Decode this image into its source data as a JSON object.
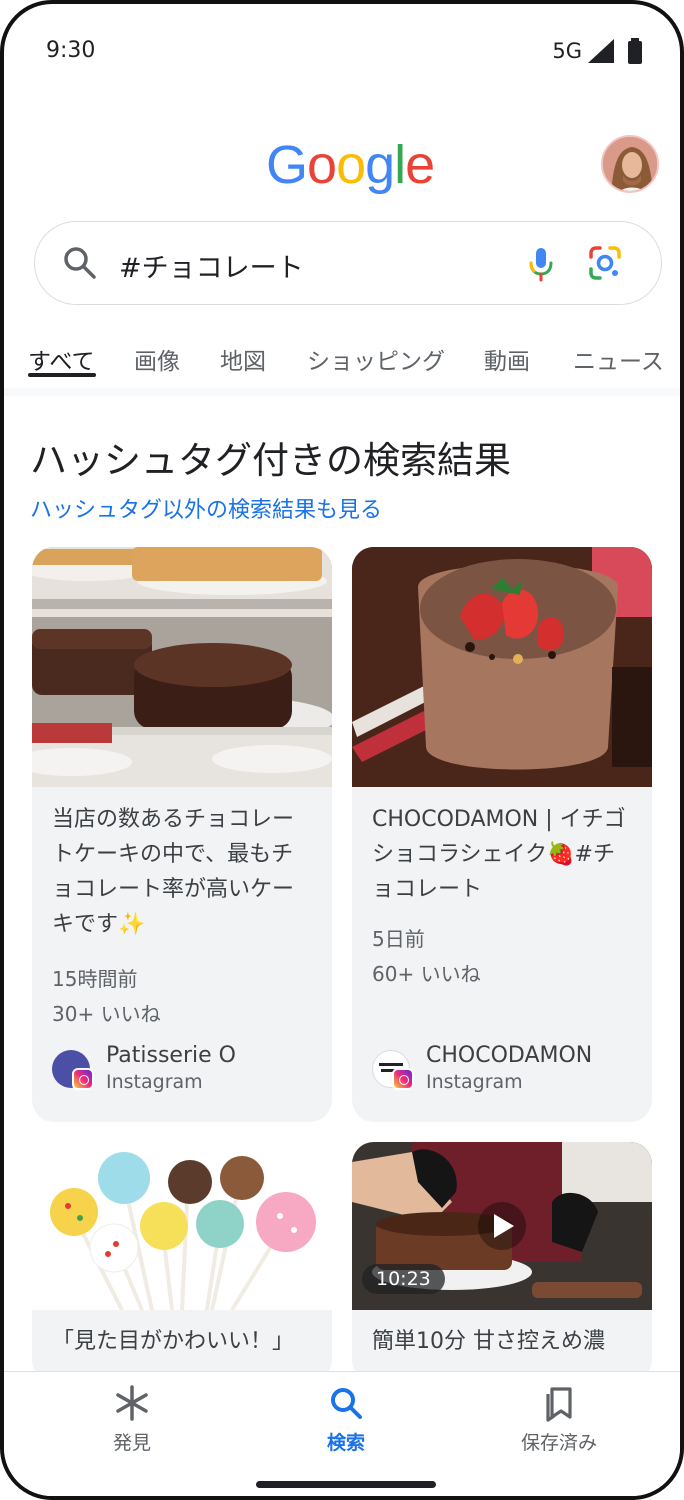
{
  "status": {
    "time": "9:30",
    "network": "5G"
  },
  "header": {
    "logo_letters": [
      "G",
      "o",
      "o",
      "g",
      "l",
      "e"
    ],
    "logo_colors": [
      "#4285F4",
      "#EA4335",
      "#FBBC05",
      "#4285F4",
      "#34A853",
      "#EA4335"
    ]
  },
  "search": {
    "query": "#チョコレート"
  },
  "tabs": [
    {
      "label": "すべて",
      "active": true
    },
    {
      "label": "画像"
    },
    {
      "label": "地図"
    },
    {
      "label": "ショッピング"
    },
    {
      "label": "動画"
    },
    {
      "label": "ニュース"
    }
  ],
  "results": {
    "title": "ハッシュタグ付きの検索結果",
    "link": "ハッシュタグ以外の検索結果も見る",
    "cards": [
      {
        "text": "当店の数あるチョコレートケーキの中で、最もチョコレート率が高いケーキです✨",
        "time": "15時間前",
        "likes": "30+ いいね",
        "source": "Patisserie O",
        "platform": "Instagram"
      },
      {
        "text": "CHOCODAMON | イチゴショコラシェイク🍓#チョコレート",
        "time": "5日前",
        "likes": "60+ いいね",
        "source": "CHOCODAMON",
        "platform": "Instagram"
      },
      {
        "text": "「見た目がかわいい！」"
      },
      {
        "text": "簡単10分 甘さ控えめ濃",
        "duration": "10:23"
      }
    ]
  },
  "bottom_nav": [
    {
      "label": "発見",
      "icon": "asterisk-icon"
    },
    {
      "label": "検索",
      "icon": "search-icon",
      "active": true
    },
    {
      "label": "保存済み",
      "icon": "bookmarks-icon"
    }
  ]
}
